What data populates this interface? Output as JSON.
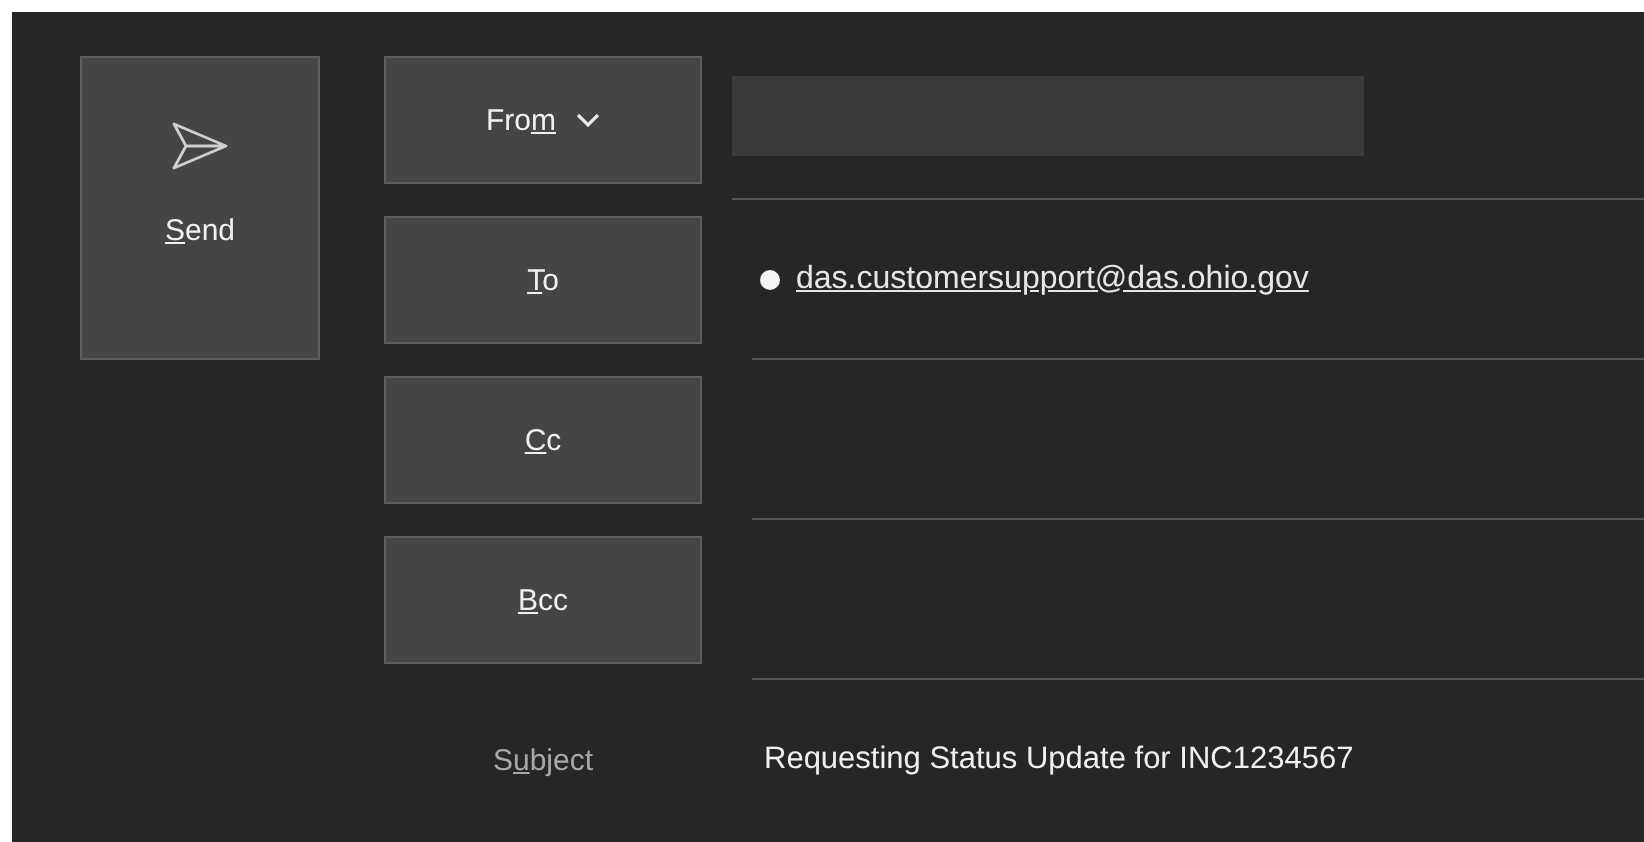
{
  "send_button": {
    "key": "S",
    "after": "end"
  },
  "address_rows": [
    {
      "kind": "dropdown",
      "label": {
        "before": "Fro",
        "key": "m"
      },
      "redacted": true
    },
    {
      "kind": "plain",
      "label": {
        "key": "T",
        "after": "o"
      },
      "recipients": [
        "das.customersupport@das.ohio.gov"
      ]
    },
    {
      "kind": "plain",
      "label": {
        "key": "C",
        "after": "c"
      }
    },
    {
      "kind": "plain",
      "label": {
        "key": "B",
        "after": "cc"
      }
    }
  ],
  "subject": {
    "label": {
      "before": "S",
      "key": "u",
      "after": "bject"
    },
    "value": "Requesting Status Update for INC1234567"
  }
}
